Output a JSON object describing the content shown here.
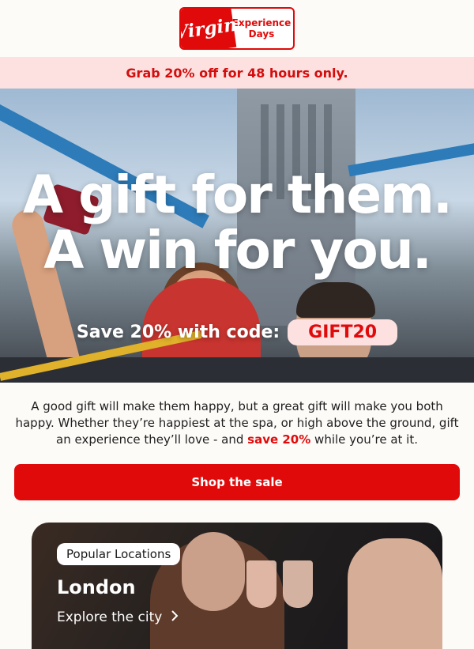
{
  "header": {
    "logo_left": "Virgin",
    "logo_right_line1": "Experience",
    "logo_right_line2": "Days"
  },
  "promo": {
    "text": "Grab 20% off for 48 hours only."
  },
  "hero": {
    "headline_line1": "A gift for them.",
    "headline_line2": "A win for you.",
    "code_label": "Save 20% with code:",
    "code": "GIFT20"
  },
  "body": {
    "text_before": "A good gift will make them happy, but a great gift will make you both happy. Whether they’re happiest at the spa, or high above the ground, gift an experience they’ll love - and ",
    "highlight": "save 20%",
    "text_after": " while you’re at it."
  },
  "cta": {
    "label": "Shop the sale"
  },
  "location_card": {
    "tag": "Popular Locations",
    "city": "London",
    "link": "Explore the city"
  },
  "colors": {
    "brand_red": "#e10a0a",
    "banner_pink": "#fde1e1"
  },
  "icons": {
    "explore_arrow": "chevron-right-icon"
  }
}
